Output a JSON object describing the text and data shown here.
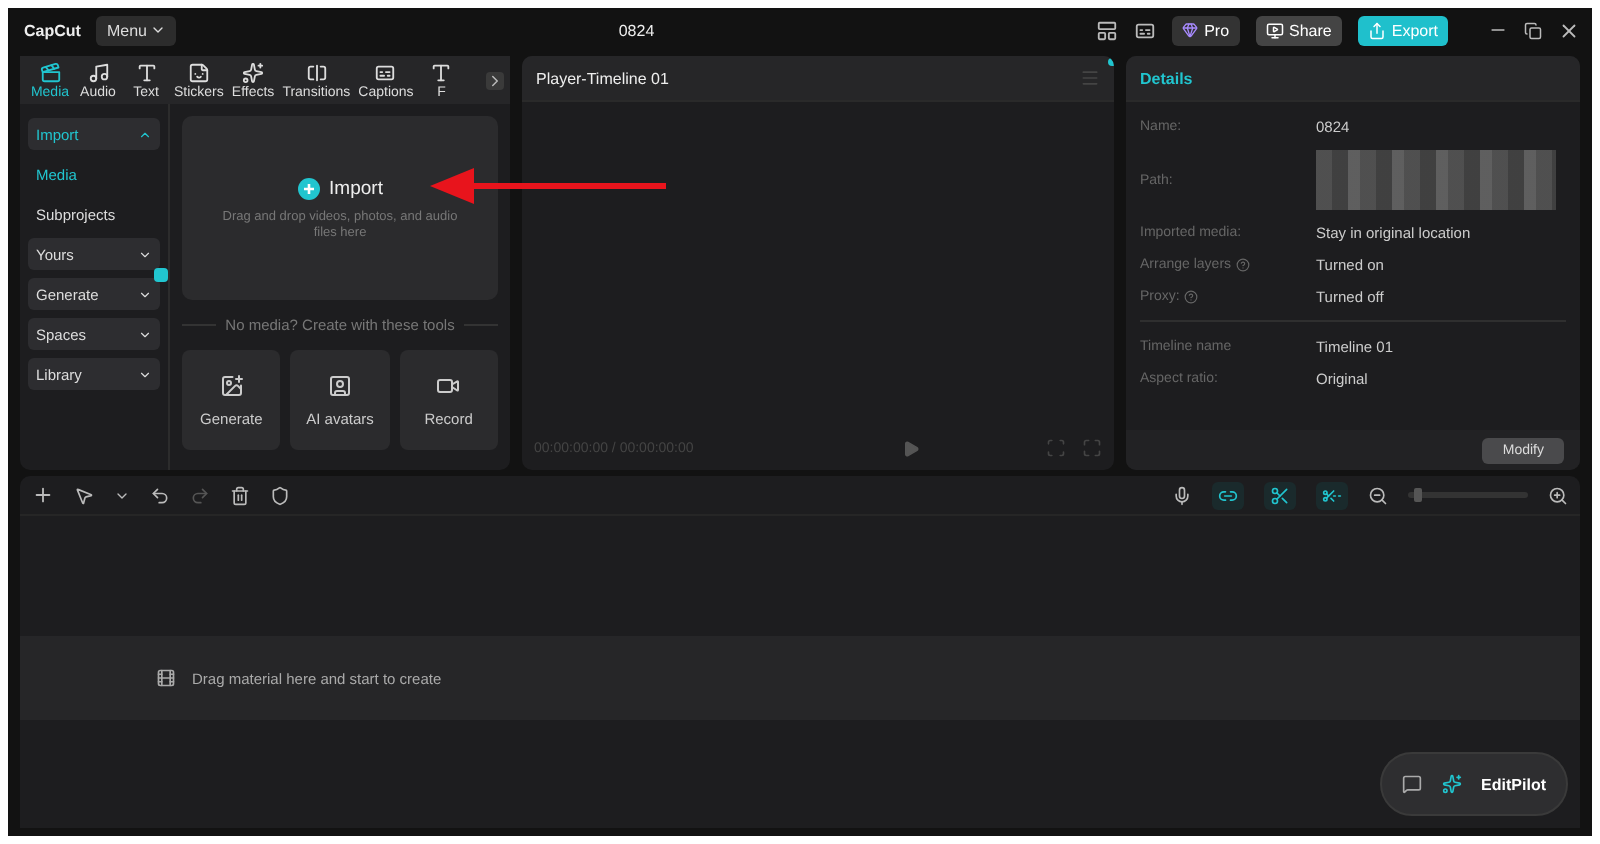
{
  "app": {
    "logo": "CapCut",
    "menu": "Menu",
    "title": "0824",
    "pro": "Pro",
    "share": "Share",
    "export": "Export"
  },
  "media_tabs": [
    {
      "label": "Media",
      "selected": true
    },
    {
      "label": "Audio",
      "selected": false
    },
    {
      "label": "Text",
      "selected": false
    },
    {
      "label": "Stickers",
      "selected": false
    },
    {
      "label": "Effects",
      "selected": false
    },
    {
      "label": "Transitions",
      "selected": false
    },
    {
      "label": "Captions",
      "selected": false
    },
    {
      "label": "F",
      "selected": false
    }
  ],
  "sidebar": [
    {
      "label": "Import",
      "kind": "group",
      "expanded": true,
      "selected": true
    },
    {
      "label": "Media",
      "kind": "item",
      "selected": true
    },
    {
      "label": "Subprojects",
      "kind": "item",
      "selected": false
    },
    {
      "label": "Yours",
      "kind": "group",
      "expanded": false,
      "selected": false
    },
    {
      "label": "Generate",
      "kind": "group",
      "expanded": false,
      "selected": false,
      "new": true
    },
    {
      "label": "Spaces",
      "kind": "group",
      "expanded": false,
      "selected": false
    },
    {
      "label": "Library",
      "kind": "group",
      "expanded": false,
      "selected": false
    }
  ],
  "import": {
    "label": "Import",
    "hint": "Drag and drop videos, photos, and audio files here"
  },
  "tools_caption": "No media? Create with these tools",
  "tools": [
    {
      "label": "Generate",
      "kind": "generate"
    },
    {
      "label": "AI avatars",
      "kind": "avatar"
    },
    {
      "label": "Record",
      "kind": "record"
    }
  ],
  "player": {
    "title": "Player-Timeline 01",
    "timecode": "00:00:00:00 / 00:00:00:00"
  },
  "details": {
    "title": "Details",
    "modify": "Modify",
    "rows": [
      {
        "label": "Name:",
        "value": "0824",
        "kind": "text"
      },
      {
        "label": "Path:",
        "kind": "blurred"
      },
      {
        "label": "Imported media:",
        "value": "Stay in original location",
        "kind": "text"
      },
      {
        "label": "Arrange layers",
        "value": "Turned on",
        "kind": "text",
        "help": true
      },
      {
        "label": "Proxy:",
        "value": "Turned off",
        "kind": "text",
        "help": true
      },
      {
        "label": "Timeline name",
        "value": "Timeline 01",
        "kind": "text",
        "divider": true
      },
      {
        "label": "Aspect ratio:",
        "value": "Original",
        "kind": "text"
      }
    ]
  },
  "timeline_toggles": [
    {
      "on": true
    },
    {
      "on": true
    },
    {
      "on": true
    }
  ],
  "zoom": {
    "level": 0.05
  },
  "timeline": {
    "hint": "Drag material here and start to create"
  },
  "editpilot": "EditPilot"
}
